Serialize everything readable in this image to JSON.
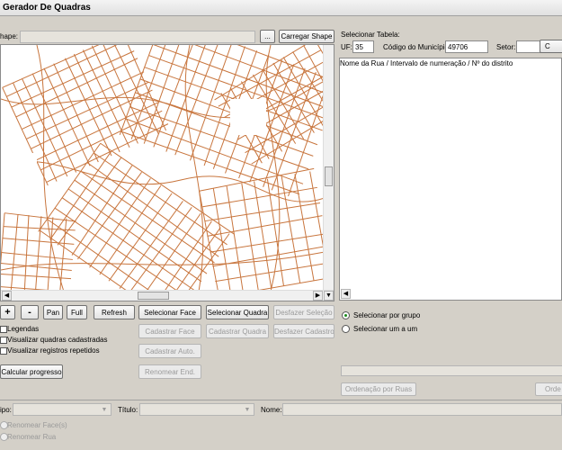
{
  "window": {
    "title": "Gerador De Quadras"
  },
  "shape": {
    "label": "hape:",
    "value": "",
    "browse_label": "...",
    "load_label": "Carregar Shape"
  },
  "table": {
    "select_label": "Selecionar Tabela:",
    "uf_label": "UF:",
    "uf_value": "35",
    "municipio_label": "Código do Município:",
    "municipio_value": "49706",
    "setor_label": "Setor:",
    "setor_value": "",
    "partial_button_label": "C",
    "list_header": "Nome da Rua / Intervalo de numeração / Nº do distrito"
  },
  "map_toolbar": {
    "zoom_in": "+",
    "zoom_out": "-",
    "pan": "Pan",
    "full": "Full",
    "refresh": "Refresh"
  },
  "actions": {
    "selecionar_face": "Selecionar Face",
    "selecionar_quadra": "Selecionar Quadra",
    "desfazer_selecao": "Desfazer Seleção",
    "cadastrar_face": "Cadastrar Face",
    "cadastrar_quadra": "Cadastrar Quadra",
    "desfazer_cadastro": "Desfazer Cadastro",
    "cadastrar_auto": "Cadastrar Auto.",
    "renomear_end": "Renomear End."
  },
  "options": {
    "legendas": "Legendas",
    "visualizar_quadras": "Visualizar quadras cadastradas",
    "visualizar_repetidos": "Visualizar registros repetidos",
    "calcular_progresso": "Calcular progresso"
  },
  "selection_mode": {
    "por_grupo": "Selecionar por grupo",
    "um_a_um": "Selecionar um a um"
  },
  "ordering": {
    "ruas": "Ordenação por Ruas",
    "partial": "Orde"
  },
  "bottom": {
    "tipo_label": "ipo:",
    "titulo_label": "Título:",
    "nome_label": "Nome:",
    "renomear_faces": "Renomear Face(s)",
    "renomear_rua": "Renomear Rua"
  },
  "colors": {
    "streets": "#c8753d"
  }
}
